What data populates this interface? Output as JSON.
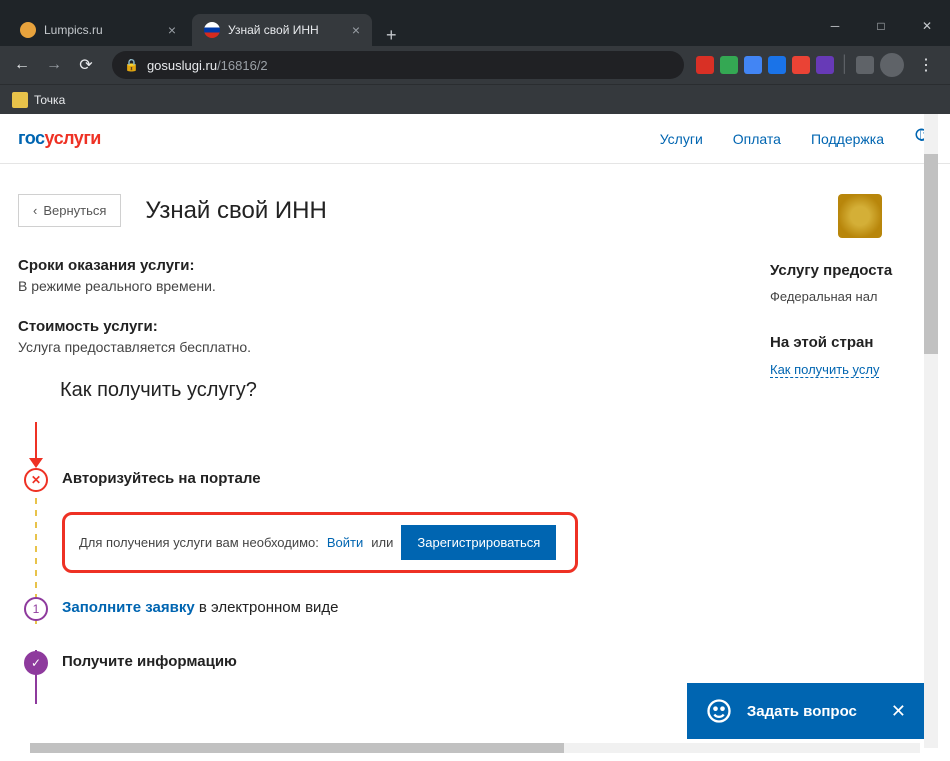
{
  "browser": {
    "tabs": [
      {
        "title": "Lumpics.ru",
        "icon_color": "#e8a33d"
      },
      {
        "title": "Узнай свой ИНН",
        "icon_color": "linear"
      }
    ],
    "url_domain": "gosuslugi.ru",
    "url_path": "/16816/2",
    "bookmark": "Точка"
  },
  "site": {
    "logo_part1": "гос",
    "logo_part2": "услуги",
    "nav": {
      "services": "Услуги",
      "payment": "Оплата",
      "support": "Поддержка"
    }
  },
  "page": {
    "back": "Вернуться",
    "title": "Узнай свой ИНН",
    "timing_title": "Сроки оказания услуги:",
    "timing_text": "В режиме реального времени.",
    "cost_title": "Стоимость услуги:",
    "cost_text": "Услуга предоставляется бесплатно.",
    "howto_title": "Как получить услугу?",
    "step1_title": "Авторизуйтесь на портале",
    "auth_prefix": "Для получения услуги вам необходимо:",
    "auth_login": "Войти",
    "auth_or": "или",
    "auth_register": "Зарегистрироваться",
    "step2_link": "Заполните заявку",
    "step2_rest": " в электронном виде",
    "step3_title": "Получите информацию"
  },
  "sidebar": {
    "provider_title": "Услугу предоста",
    "provider_text": "Федеральная нал",
    "onpage_title": "На этой стран",
    "onpage_link": "Как получить услу"
  },
  "chat": {
    "text": "Задать вопрос"
  }
}
